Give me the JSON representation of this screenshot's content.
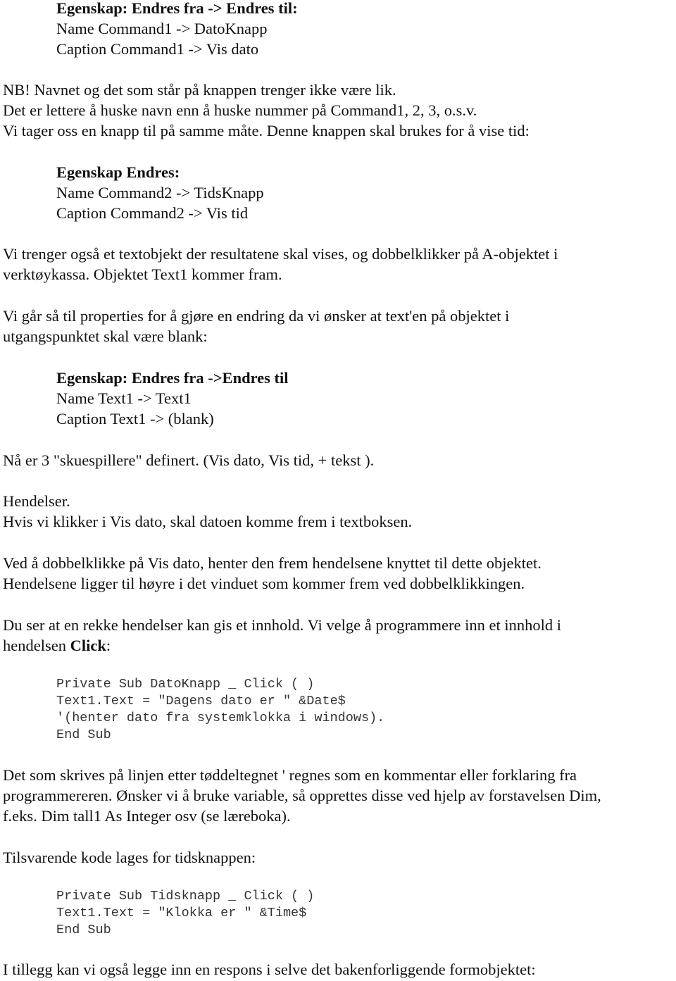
{
  "block1": {
    "heading": "Egenskap: Endres fra -> Endres til:",
    "lines": [
      "Name Command1 -> DatoKnapp",
      "Caption Command1 -> Vis dato"
    ]
  },
  "para1": [
    "NB! Navnet og det som står på knappen trenger ikke være lik.",
    "Det er lettere å huske navn enn å huske nummer på Command1, 2, 3, o.s.v.",
    "Vi tager oss en knapp til på samme måte. Denne knappen skal brukes for å vise tid:"
  ],
  "block2": {
    "heading": "Egenskap Endres:",
    "lines": [
      "Name Command2 -> TidsKnapp",
      "Caption Command2 -> Vis tid"
    ]
  },
  "para2": [
    "Vi trenger også et textobjekt der resultatene skal vises, og dobbelklikker på A-objektet i",
    "verktøykassa. Objektet Text1 kommer fram."
  ],
  "para3": [
    "Vi går så til properties for å gjøre en endring da vi ønsker at text'en på objektet i",
    "utgangspunktet skal være blank:"
  ],
  "block3": {
    "heading": "Egenskap: Endres fra ->Endres til",
    "lines": [
      "Name Text1 -> Text1",
      "Caption Text1 -> (blank)"
    ]
  },
  "para4": "Nå er 3 \"skuespillere\" definert. (Vis dato, Vis tid, + tekst ).",
  "para5": [
    "Hendelser.",
    "Hvis vi klikker i Vis dato, skal datoen komme frem i textboksen."
  ],
  "para6": [
    "Ved å dobbelklikke på Vis dato, henter den frem hendelsene knyttet til dette objektet.",
    "Hendelsene ligger til høyre i det vinduet som kommer frem ved dobbelklikkingen."
  ],
  "para7": {
    "line1": "Du ser at en rekke hendelser kan gis et innhold. Vi velge å programmere inn et innhold i",
    "line2_prefix": "hendelsen ",
    "line2_bold": "Click",
    "line2_suffix": ":"
  },
  "code1": [
    "Private Sub DatoKnapp _ Click ( )",
    "Text1.Text = \"Dagens dato er \" &Date$",
    "'(henter dato fra systemklokka i windows).",
    "End Sub"
  ],
  "para8": [
    "Det som skrives på linjen etter tøddeltegnet ' regnes som en kommentar eller forklaring fra",
    "programmereren. Ønsker vi å bruke variable, så opprettes disse ved hjelp av forstavelsen Dim,",
    "f.eks. Dim tall1 As Integer osv (se læreboka)."
  ],
  "para9": "Tilsvarende kode lages for tidsknappen:",
  "code2": [
    "Private Sub Tidsknapp _ Click ( )",
    "Text1.Text = \"Klokka er \" &Time$",
    "End Sub"
  ],
  "para10": "I tillegg kan vi også legge inn en respons i selve det bakenforliggende formobjektet:"
}
